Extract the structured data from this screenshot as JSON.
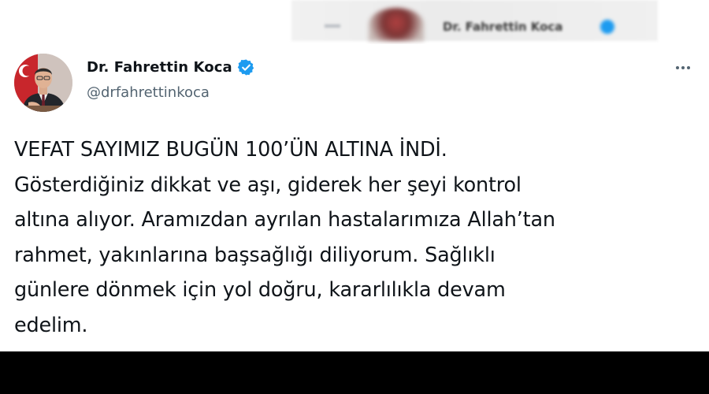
{
  "header_blur": {
    "name": "Dr. Fahrettin Koca"
  },
  "tweet": {
    "author_name": "Dr. Fahrettin Koca",
    "author_handle": "@drfahrettinkoca",
    "verified_icon": "verified-badge-icon",
    "more_icon": "more-options-icon",
    "text_lines": [
      "VEFAT SAYIMIZ BUGÜN 100’ÜN ALTINA İNDİ.",
      "Gösterdiğiniz dikkat ve aşı, giderek her şeyi kontrol",
      "altına alıyor. Aramızdan ayrılan hastalarımıza Allah’tan",
      "rahmet, yakınlarına başsağlığı diliyorum. Sağlıklı",
      "günlere dönmek için yol doğru, kararlılıkla devam",
      "edelim."
    ]
  },
  "colors": {
    "name": "#0f1419",
    "handle": "#536471",
    "verified": "#1d9bf0",
    "bottom_bar": "#000000"
  }
}
